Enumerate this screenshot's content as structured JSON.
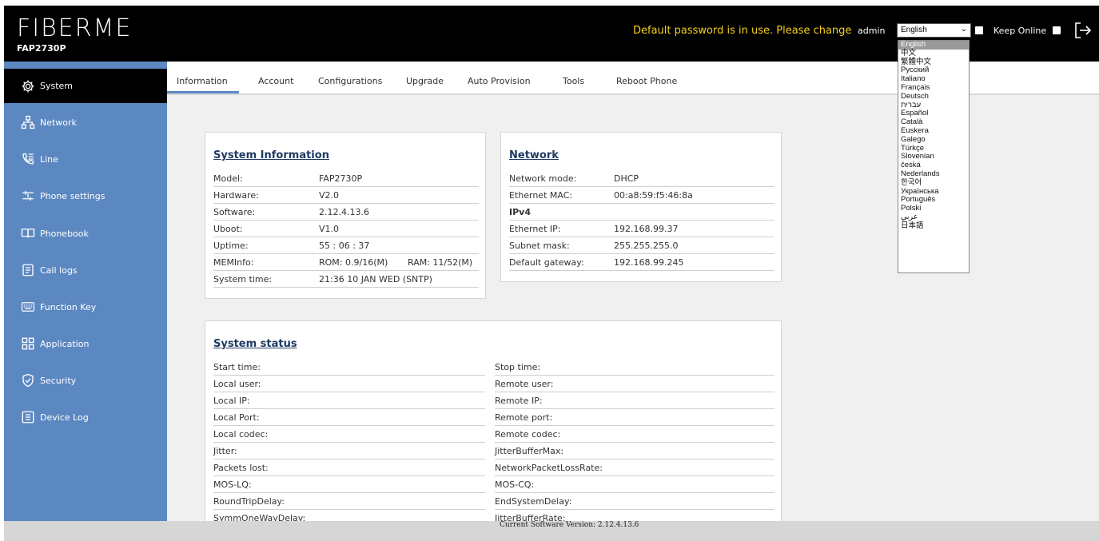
{
  "header": {
    "logo_text": "FIBERME",
    "model": "FAP2730P",
    "warning": "Default password is in use. Please change",
    "user": "admin",
    "language_selected": "English",
    "keep_online_label": "Keep Online"
  },
  "language_options": [
    "English",
    "中文",
    "繁體中文",
    "Русский",
    "Italiano",
    "Français",
    "Deutsch",
    "עברית",
    "Español",
    "Català",
    "Euskera",
    "Galego",
    "Türkçe",
    "Slovenian",
    "česká",
    "Nederlands",
    "한국어",
    "Українська",
    "Português",
    "Polski",
    "عربي",
    "日本語"
  ],
  "sidebar": {
    "items": [
      {
        "label": "System",
        "icon": "gear-icon"
      },
      {
        "label": "Network",
        "icon": "network-icon"
      },
      {
        "label": "Line",
        "icon": "phone-line-icon"
      },
      {
        "label": "Phone settings",
        "icon": "sliders-icon"
      },
      {
        "label": "Phonebook",
        "icon": "book-icon"
      },
      {
        "label": "Call logs",
        "icon": "document-icon"
      },
      {
        "label": "Function Key",
        "icon": "keyboard-icon"
      },
      {
        "label": "Application",
        "icon": "grid-icon"
      },
      {
        "label": "Security",
        "icon": "shield-icon"
      },
      {
        "label": "Device Log",
        "icon": "log-icon"
      }
    ]
  },
  "tabs": [
    "Information",
    "Account",
    "Configurations",
    "Upgrade",
    "Auto Provision",
    "Tools",
    "Reboot Phone"
  ],
  "system_info": {
    "title": "System Information",
    "rows": [
      {
        "label": "Model:",
        "value": "FAP2730P"
      },
      {
        "label": "Hardware:",
        "value": "V2.0"
      },
      {
        "label": "Software:",
        "value": "2.12.4.13.6"
      },
      {
        "label": "Uboot:",
        "value": "V1.0"
      },
      {
        "label": "Uptime:",
        "value": "55 : 06 : 37"
      },
      {
        "label": "MEMInfo:",
        "value": "ROM: 0.9/16(M)",
        "value2": "RAM: 11/52(M)"
      },
      {
        "label": "System time:",
        "value": "21:36 10 JAN WED (SNTP)"
      }
    ]
  },
  "network": {
    "title": "Network",
    "rows": [
      {
        "label": "Network mode:",
        "value": "DHCP"
      },
      {
        "label": "Ethernet MAC:",
        "value": "00:a8:59:f5:46:8a"
      },
      {
        "label": "IPv4",
        "value": ""
      },
      {
        "label": "Ethernet IP:",
        "value": "192.168.99.37"
      },
      {
        "label": "Subnet mask:",
        "value": "255.255.255.0"
      },
      {
        "label": "Default gateway:",
        "value": "192.168.99.245"
      }
    ]
  },
  "system_status": {
    "title": "System status",
    "left": [
      "Start time:",
      "Local user:",
      "Local IP:",
      "Local Port:",
      "Local codec:",
      "Jitter:",
      "Packets lost:",
      "MOS-LQ:",
      "RoundTripDelay:",
      "SymmOneWayDelay:"
    ],
    "right": [
      "Stop time:",
      "Remote user:",
      "Remote IP:",
      "Remote port:",
      "Remote codec:",
      "JitterBufferMax:",
      "NetworkPacketLossRate:",
      "MOS-CQ:",
      "EndSystemDelay:",
      "JitterBufferRate:"
    ]
  },
  "footer": {
    "text": "Current Software Version: 2.12.4.13.6"
  }
}
